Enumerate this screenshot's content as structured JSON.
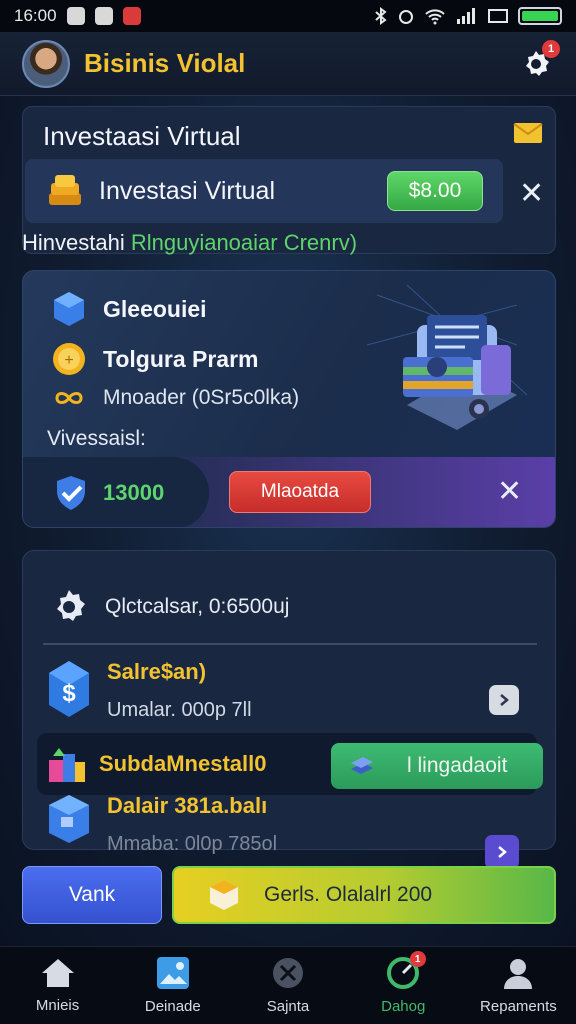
{
  "status_bar": {
    "time": "16:00",
    "app_icon_colors": [
      "#d8d8d8",
      "#d8d8d8",
      "#d93a3a"
    ],
    "battery_color": "#39d353"
  },
  "header": {
    "title": "Bisinis Violal",
    "notification_count": "1",
    "title_color": "#f2c230"
  },
  "card_invest": {
    "title": "Investaasi Virtual",
    "row_label": "Investasi Virtual",
    "price_label": "$8.00"
  },
  "subheading": {
    "prefix": "Hinvestahi",
    "accent": "Rlnguyianoaiar Crenrv)"
  },
  "card_feature": {
    "rows": [
      {
        "label": "Gleeouiei",
        "icon": "cube-icon"
      },
      {
        "label": "Tolgura Prarm",
        "icon": "coin-icon"
      },
      {
        "label": "Mnoader (0Sr5c0lka)",
        "icon": "infinity-icon"
      }
    ],
    "section_label": "Vivessaisl:",
    "amount": "13000",
    "action_label": "Mlaoatda"
  },
  "card_list": {
    "settings_label": "Qlctcalsar, 0:6500uj",
    "items": [
      {
        "title": "Salre$an)",
        "subtitle": "Umalar. 000p 7ll"
      },
      {
        "title": "SubdaMnestall0",
        "button_label": "l lingadaoit"
      },
      {
        "title": "Dalair 381a.balı",
        "subtitle": "Mmaba: 0l0p 785ol"
      }
    ]
  },
  "actions": {
    "left_label": "Vank",
    "right_label": "Gerls. Olalalrl 200"
  },
  "bottom_nav": {
    "items": [
      {
        "label": "Mnieis",
        "icon": "home-icon"
      },
      {
        "label": "Deinade",
        "icon": "photo-icon"
      },
      {
        "label": "Sajnta",
        "icon": "compass-icon"
      },
      {
        "label": "Dahog",
        "icon": "gauge-icon",
        "active": true,
        "badge": "1"
      },
      {
        "label": "Repaments",
        "icon": "user-icon"
      }
    ],
    "active_color": "#3fb96a"
  }
}
